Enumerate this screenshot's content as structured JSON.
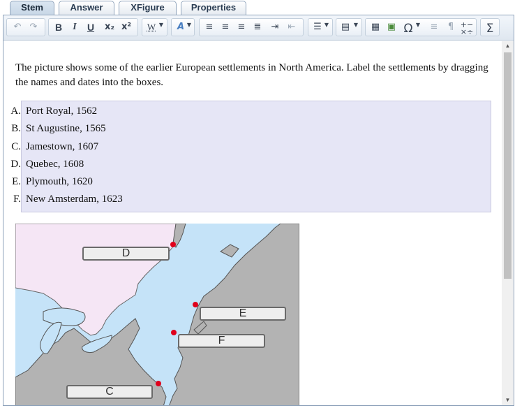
{
  "tabs": [
    {
      "label": "Stem",
      "active": true
    },
    {
      "label": "Answer",
      "active": false
    },
    {
      "label": "XFigure",
      "active": false
    },
    {
      "label": "Properties",
      "active": false
    }
  ],
  "toolbar": {
    "undo_icon": "undo-icon",
    "redo_icon": "redo-icon",
    "bold": "B",
    "italic": "I",
    "underline": "U",
    "subscript": "x₂",
    "superscript": "x²",
    "word_style": "W",
    "sum_symbol": "Σ",
    "omega_symbol": "Ω",
    "pilcrow": "¶"
  },
  "question": {
    "prompt": "The picture shows some of the earlier European settlements in North America. Label the settlements by dragging the names and dates into the boxes.",
    "choices": [
      {
        "letter": "A.",
        "text": "Port Royal, 1562"
      },
      {
        "letter": "B.",
        "text": "St Augustine, 1565"
      },
      {
        "letter": "C.",
        "text": "Jamestown, 1607"
      },
      {
        "letter": "D.",
        "text": "Quebec, 1608"
      },
      {
        "letter": "E.",
        "text": "Plymouth, 1620"
      },
      {
        "letter": "F.",
        "text": "New Amsterdam, 1623"
      }
    ]
  },
  "map": {
    "drop_boxes": {
      "d": "D",
      "e": "E",
      "f": "F",
      "c": "C"
    },
    "colors": {
      "water": "#c5e3f8",
      "land_gray": "#b3b3b3",
      "land_pink": "#f5e6f5",
      "marker": "#e0001b"
    }
  },
  "scrollbar": {
    "up": "▲",
    "down": "▼"
  }
}
